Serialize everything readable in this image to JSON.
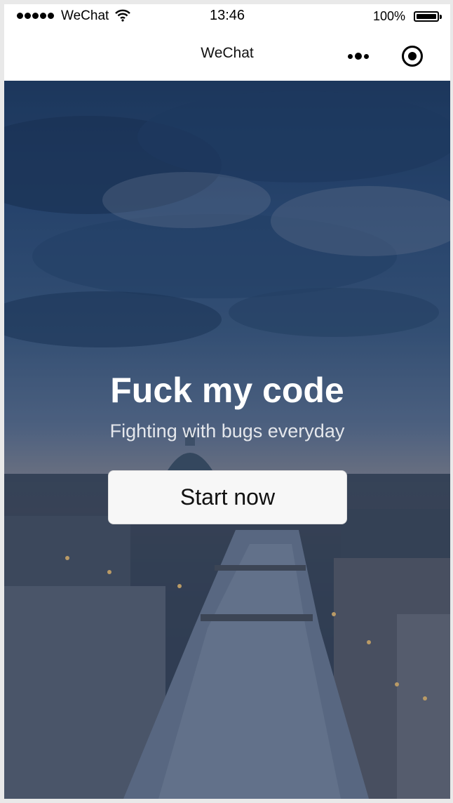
{
  "status_bar": {
    "carrier": "WeChat",
    "time": "13:46",
    "battery": "100%"
  },
  "nav_bar": {
    "title": "WeChat",
    "more_icon": "more-dots-icon",
    "close_icon": "target-close-icon"
  },
  "hero": {
    "title": "Fuck my code",
    "subtitle": "Fighting with bugs everyday",
    "button_label": "Start now"
  },
  "colors": {
    "button_bg": "#f7f7f7",
    "title_text": "#ffffff"
  }
}
